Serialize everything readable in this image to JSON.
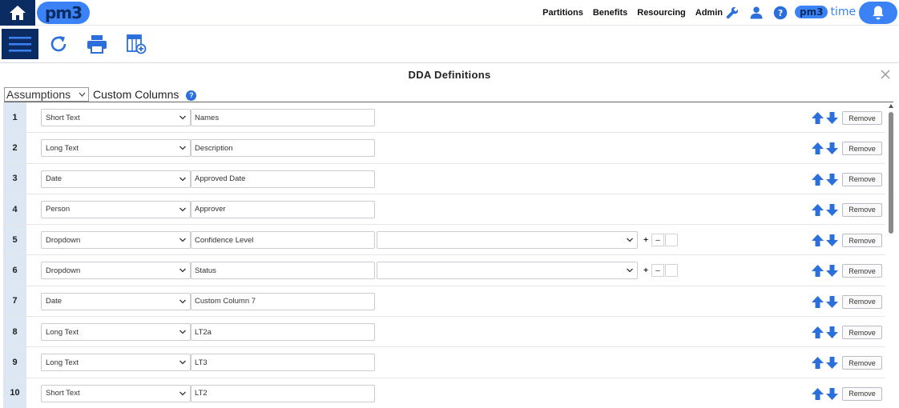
{
  "nav": {
    "logo": "pm3",
    "links": [
      "Partitions",
      "Benefits",
      "Resourcing",
      "Admin"
    ],
    "time_logo": "pm3",
    "time_word": "time"
  },
  "toolbar": {
    "icons": [
      "menu-icon",
      "refresh-icon",
      "print-icon",
      "add-column-icon"
    ]
  },
  "dialog": {
    "title": "DDA Definitions",
    "filter_select": "Assumptions",
    "filter_label": "Custom Columns",
    "help_glyph": "?"
  },
  "rows": [
    {
      "num": "1",
      "type": "Short Text",
      "name": "Names",
      "has_options": false
    },
    {
      "num": "2",
      "type": "Long Text",
      "name": "Description",
      "has_options": false
    },
    {
      "num": "3",
      "type": "Date",
      "name": "Approved Date",
      "has_options": false
    },
    {
      "num": "4",
      "type": "Person",
      "name": "Approver",
      "has_options": false
    },
    {
      "num": "5",
      "type": "Dropdown",
      "name": "Confidence Level",
      "has_options": true
    },
    {
      "num": "6",
      "type": "Dropdown",
      "name": "Status",
      "has_options": true
    },
    {
      "num": "7",
      "type": "Date",
      "name": "Custom Column 7",
      "has_options": false
    },
    {
      "num": "8",
      "type": "Long Text",
      "name": "LT2a",
      "has_options": false
    },
    {
      "num": "9",
      "type": "Long Text",
      "name": "LT3",
      "has_options": false
    },
    {
      "num": "10",
      "type": "Short Text",
      "name": "LT2",
      "has_options": false
    }
  ],
  "row_labels": {
    "remove": "Remove",
    "plus": "+",
    "minus": "–"
  },
  "colors": {
    "navy": "#0b2b63",
    "accent": "#3b82f6",
    "arrow": "#2a6fdb"
  }
}
